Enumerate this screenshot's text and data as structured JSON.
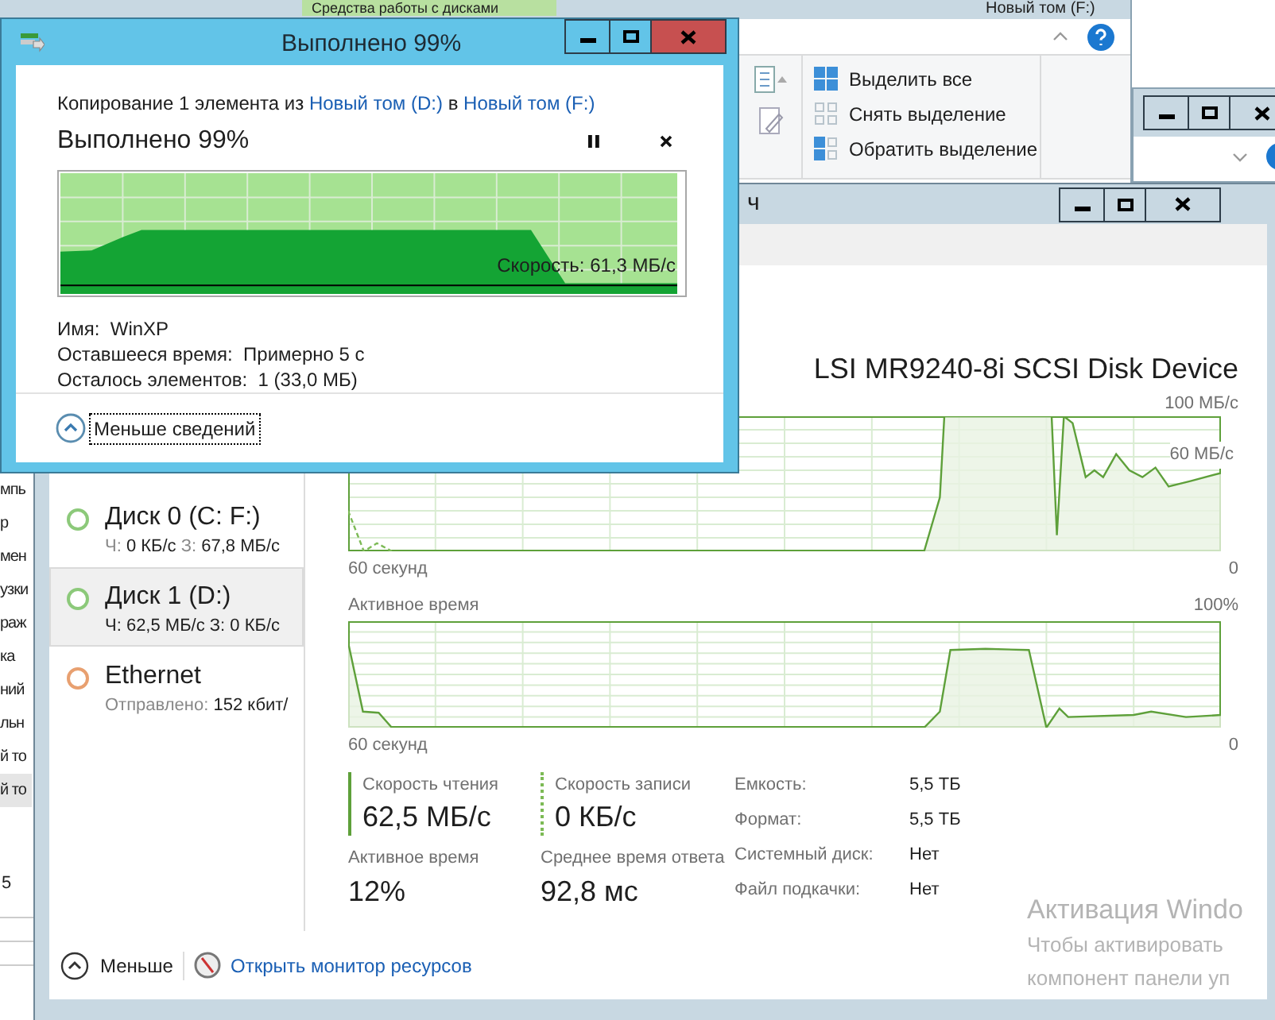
{
  "explorer": {
    "ribbon_tab": "Средства работы с дисками",
    "title": "Новый том (F:)",
    "ribbon_buttons": [
      {
        "label": "Выделить все",
        "kind": "all"
      },
      {
        "label": "Снять выделение",
        "kind": "none"
      },
      {
        "label": "Обратить выделение",
        "kind": "invert"
      }
    ],
    "nav_items": [
      {
        "label": "мпь",
        "selected": false
      },
      {
        "label": "р",
        "selected": false
      },
      {
        "label": "мен",
        "selected": false
      },
      {
        "label": "узки",
        "selected": false
      },
      {
        "label": "раж",
        "selected": false
      },
      {
        "label": "ка",
        "selected": false
      },
      {
        "label": "ний",
        "selected": false
      },
      {
        "label": "льн",
        "selected": false
      },
      {
        "label": "й то",
        "selected": false
      },
      {
        "label": "й то",
        "selected": true
      }
    ],
    "status_text": "5"
  },
  "task_manager": {
    "title": "ч",
    "devices": [
      {
        "name": "Диск 0 (C: F:)",
        "selected": false,
        "color": "#8cc97a",
        "details": [
          {
            "label": "Ч:",
            "value": "0 КБ/с"
          },
          {
            "label": "З:",
            "value": "67,8 МБ/с"
          }
        ]
      },
      {
        "name": "Диск 1 (D:)",
        "selected": true,
        "color": "#8cc97a",
        "details": [
          {
            "label": "Ч:",
            "value": "62,5 МБ/с"
          },
          {
            "label": "З:",
            "value": "0 КБ/с"
          }
        ]
      },
      {
        "name": "Ethernet",
        "selected": false,
        "color": "#e8a070",
        "details": [
          {
            "label": "Отправлено:",
            "value": "152 кбит/"
          }
        ]
      }
    ],
    "device_title": "LSI MR9240-8i SCSI Disk Device",
    "transfer_graph": {
      "max_label": "100 МБ/с",
      "mid_label": "60 МБ/с",
      "left_label": "60 секунд",
      "right_label": "0"
    },
    "active_graph": {
      "title": "Активное время",
      "max_label": "100%",
      "left_label": "60 секунд",
      "right_label": "0"
    },
    "stats": [
      {
        "label": "Скорость чтения",
        "value": "62,5 МБ/с",
        "kind": "solid"
      },
      {
        "label": "Скорость записи",
        "value": "0 КБ/с",
        "kind": "dotted"
      },
      {
        "label": "Активное время",
        "value": "12%",
        "kind": "plain"
      },
      {
        "label": "Среднее время ответа",
        "value": "92,8 мс",
        "kind": "plain"
      }
    ],
    "properties": [
      {
        "label": "Емкость:",
        "value": "5,5 ТБ"
      },
      {
        "label": "Формат:",
        "value": "5,5 ТБ"
      },
      {
        "label": "Системный диск:",
        "value": "Нет"
      },
      {
        "label": "Файл подкачки:",
        "value": "Нет"
      }
    ],
    "less_button": "Меньше",
    "monitor_link": "Открыть монитор ресурсов"
  },
  "copy_dialog": {
    "title": "Выполнено 99%",
    "heading": [
      {
        "text": "Копирование 1 элемента из",
        "kind": "text"
      },
      {
        "text": "Новый том (D:)",
        "kind": "link"
      },
      {
        "text": "в",
        "kind": "text"
      },
      {
        "text": "Новый том (F:)",
        "kind": "link"
      }
    ],
    "progress_text": "Выполнено 99%",
    "level": 0.99,
    "speed": "Скорость: 61,3 МБ/с",
    "details": [
      {
        "label": "Имя:",
        "value": "WinXP"
      },
      {
        "label": "Оставшееся время:",
        "value": "Примерно 5 с"
      },
      {
        "label": "Осталось элементов:",
        "value": "1 (33,0 МБ)"
      }
    ],
    "toggle": "Меньше сведений"
  },
  "activation": [
    "Активация Windo",
    "Чтобы активировать",
    "компонент панели уп"
  ]
}
